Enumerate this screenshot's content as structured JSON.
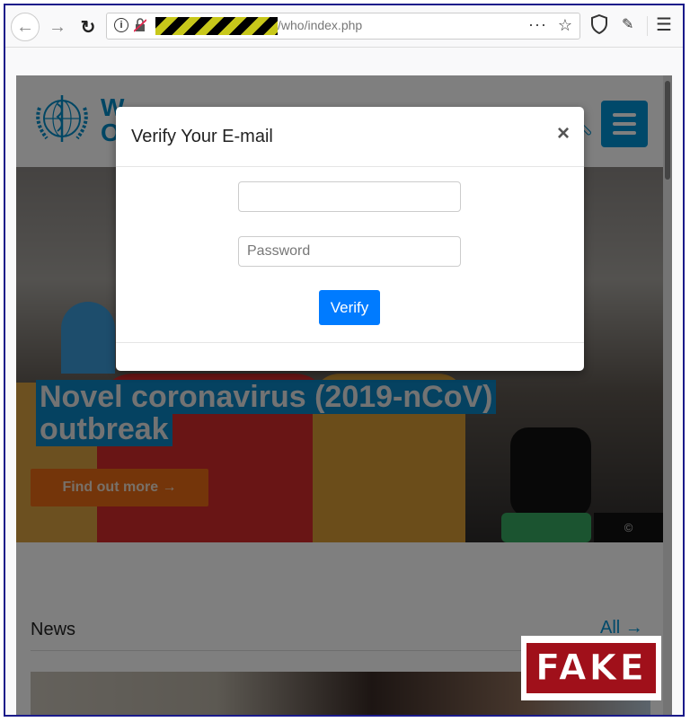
{
  "browser": {
    "url_path": "/who/index.php",
    "url_redacted": true,
    "icons": {
      "back": "arrow-left",
      "forward": "arrow-right",
      "reload": "reload",
      "info": "info-circle",
      "insecure_lock": "lock-strikethrough",
      "page_actions": "ellipsis",
      "bookmark": "star",
      "tracking_protection": "shield",
      "extension": "magic-wand",
      "menu": "hamburger"
    },
    "glyphs": {
      "back": "←",
      "forward": "→",
      "reload": "↻",
      "info": "i",
      "more": "···",
      "star": "☆",
      "wand": "✎",
      "menu": "☰"
    }
  },
  "site": {
    "org_name_partial": "W\nO",
    "hero": {
      "title": "Novel coronavirus (2019-nCoV) outbreak",
      "title_line1": "Novel coronavirus (2019-nCoV)",
      "title_line2": "outbreak",
      "cta_label": "Find out more →",
      "copyright_icon": "©"
    },
    "news": {
      "heading": "News",
      "all_link": "All →"
    }
  },
  "modal": {
    "title": "Verify Your E-mail",
    "close_glyph": "×",
    "email_field": {
      "value": "",
      "placeholder": ""
    },
    "password_field": {
      "value": "",
      "placeholder": "Password"
    },
    "submit_label": "Verify"
  },
  "stamp": {
    "label": "FAKE"
  },
  "colors": {
    "who_blue": "#0093d5",
    "cta_orange": "#e96a15",
    "verify_blue": "#007bff",
    "fake_red": "#a0101a",
    "frame_border": "#1a1a8a"
  }
}
